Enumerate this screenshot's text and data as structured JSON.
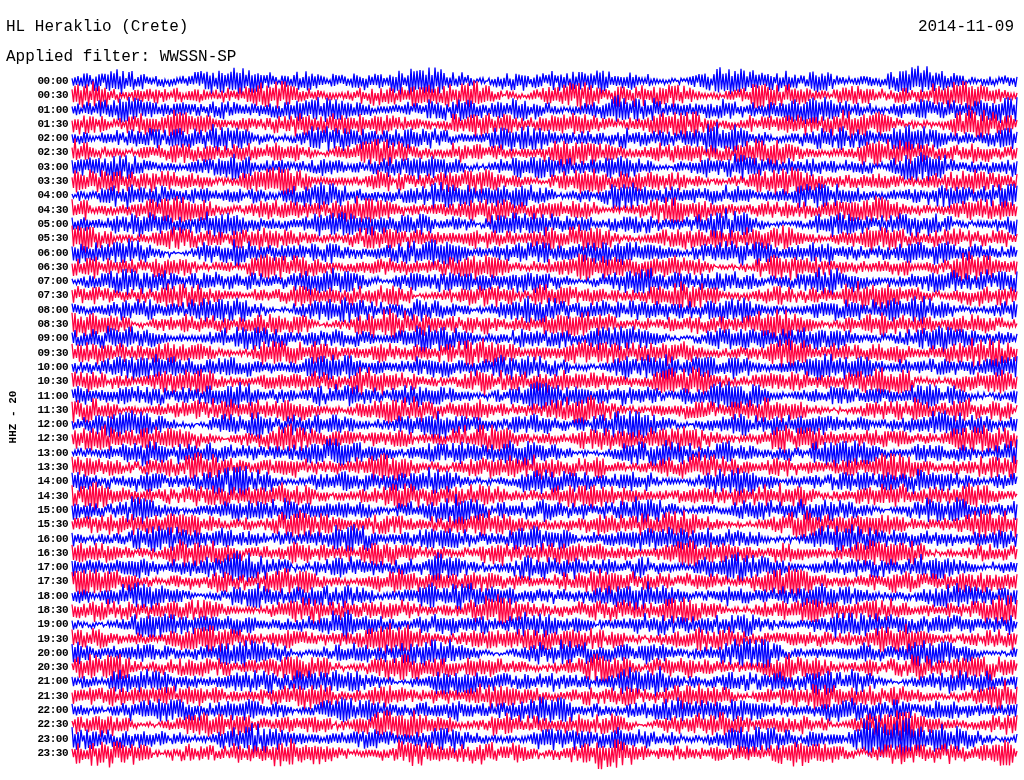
{
  "header": {
    "station": "HL Heraklio (Crete)",
    "date": "2014-11-09",
    "filter": "Applied filter: WWSSN-SP"
  },
  "channel": "HHZ - 20",
  "traces": [
    {
      "time": "00:00",
      "color": "#0000ff"
    },
    {
      "time": "00:30",
      "color": "#ff0040"
    },
    {
      "time": "01:00",
      "color": "#0000ff"
    },
    {
      "time": "01:30",
      "color": "#ff0040"
    },
    {
      "time": "02:00",
      "color": "#0000ff"
    },
    {
      "time": "02:30",
      "color": "#ff0040"
    },
    {
      "time": "03:00",
      "color": "#0000ff"
    },
    {
      "time": "03:30",
      "color": "#ff0040"
    },
    {
      "time": "04:00",
      "color": "#0000ff"
    },
    {
      "time": "04:30",
      "color": "#ff0040"
    },
    {
      "time": "05:00",
      "color": "#0000ff"
    },
    {
      "time": "05:30",
      "color": "#ff0040"
    },
    {
      "time": "06:00",
      "color": "#0000ff"
    },
    {
      "time": "06:30",
      "color": "#ff0040"
    },
    {
      "time": "07:00",
      "color": "#0000ff"
    },
    {
      "time": "07:30",
      "color": "#ff0040"
    },
    {
      "time": "08:00",
      "color": "#0000ff"
    },
    {
      "time": "08:30",
      "color": "#ff0040"
    },
    {
      "time": "09:00",
      "color": "#0000ff"
    },
    {
      "time": "09:30",
      "color": "#ff0040"
    },
    {
      "time": "10:00",
      "color": "#0000ff"
    },
    {
      "time": "10:30",
      "color": "#ff0040"
    },
    {
      "time": "11:00",
      "color": "#0000ff"
    },
    {
      "time": "11:30",
      "color": "#ff0040"
    },
    {
      "time": "12:00",
      "color": "#0000ff"
    },
    {
      "time": "12:30",
      "color": "#ff0040"
    },
    {
      "time": "13:00",
      "color": "#0000ff"
    },
    {
      "time": "13:30",
      "color": "#ff0040"
    },
    {
      "time": "14:00",
      "color": "#0000ff"
    },
    {
      "time": "14:30",
      "color": "#ff0040"
    },
    {
      "time": "15:00",
      "color": "#0000ff"
    },
    {
      "time": "15:30",
      "color": "#ff0040"
    },
    {
      "time": "16:00",
      "color": "#0000ff"
    },
    {
      "time": "16:30",
      "color": "#ff0040"
    },
    {
      "time": "17:00",
      "color": "#0000ff"
    },
    {
      "time": "17:30",
      "color": "#ff0040"
    },
    {
      "time": "18:00",
      "color": "#0000ff"
    },
    {
      "time": "18:30",
      "color": "#ff0040"
    },
    {
      "time": "19:00",
      "color": "#0000ff"
    },
    {
      "time": "19:30",
      "color": "#ff0040"
    },
    {
      "time": "20:00",
      "color": "#0000ff"
    },
    {
      "time": "20:30",
      "color": "#ff0040"
    },
    {
      "time": "21:00",
      "color": "#0000ff"
    },
    {
      "time": "21:30",
      "color": "#ff0040"
    },
    {
      "time": "22:00",
      "color": "#0000ff"
    },
    {
      "time": "22:30",
      "color": "#ff0040"
    },
    {
      "time": "23:00",
      "color": "#0000ff"
    },
    {
      "time": "23:30",
      "color": "#ff0040"
    }
  ]
}
